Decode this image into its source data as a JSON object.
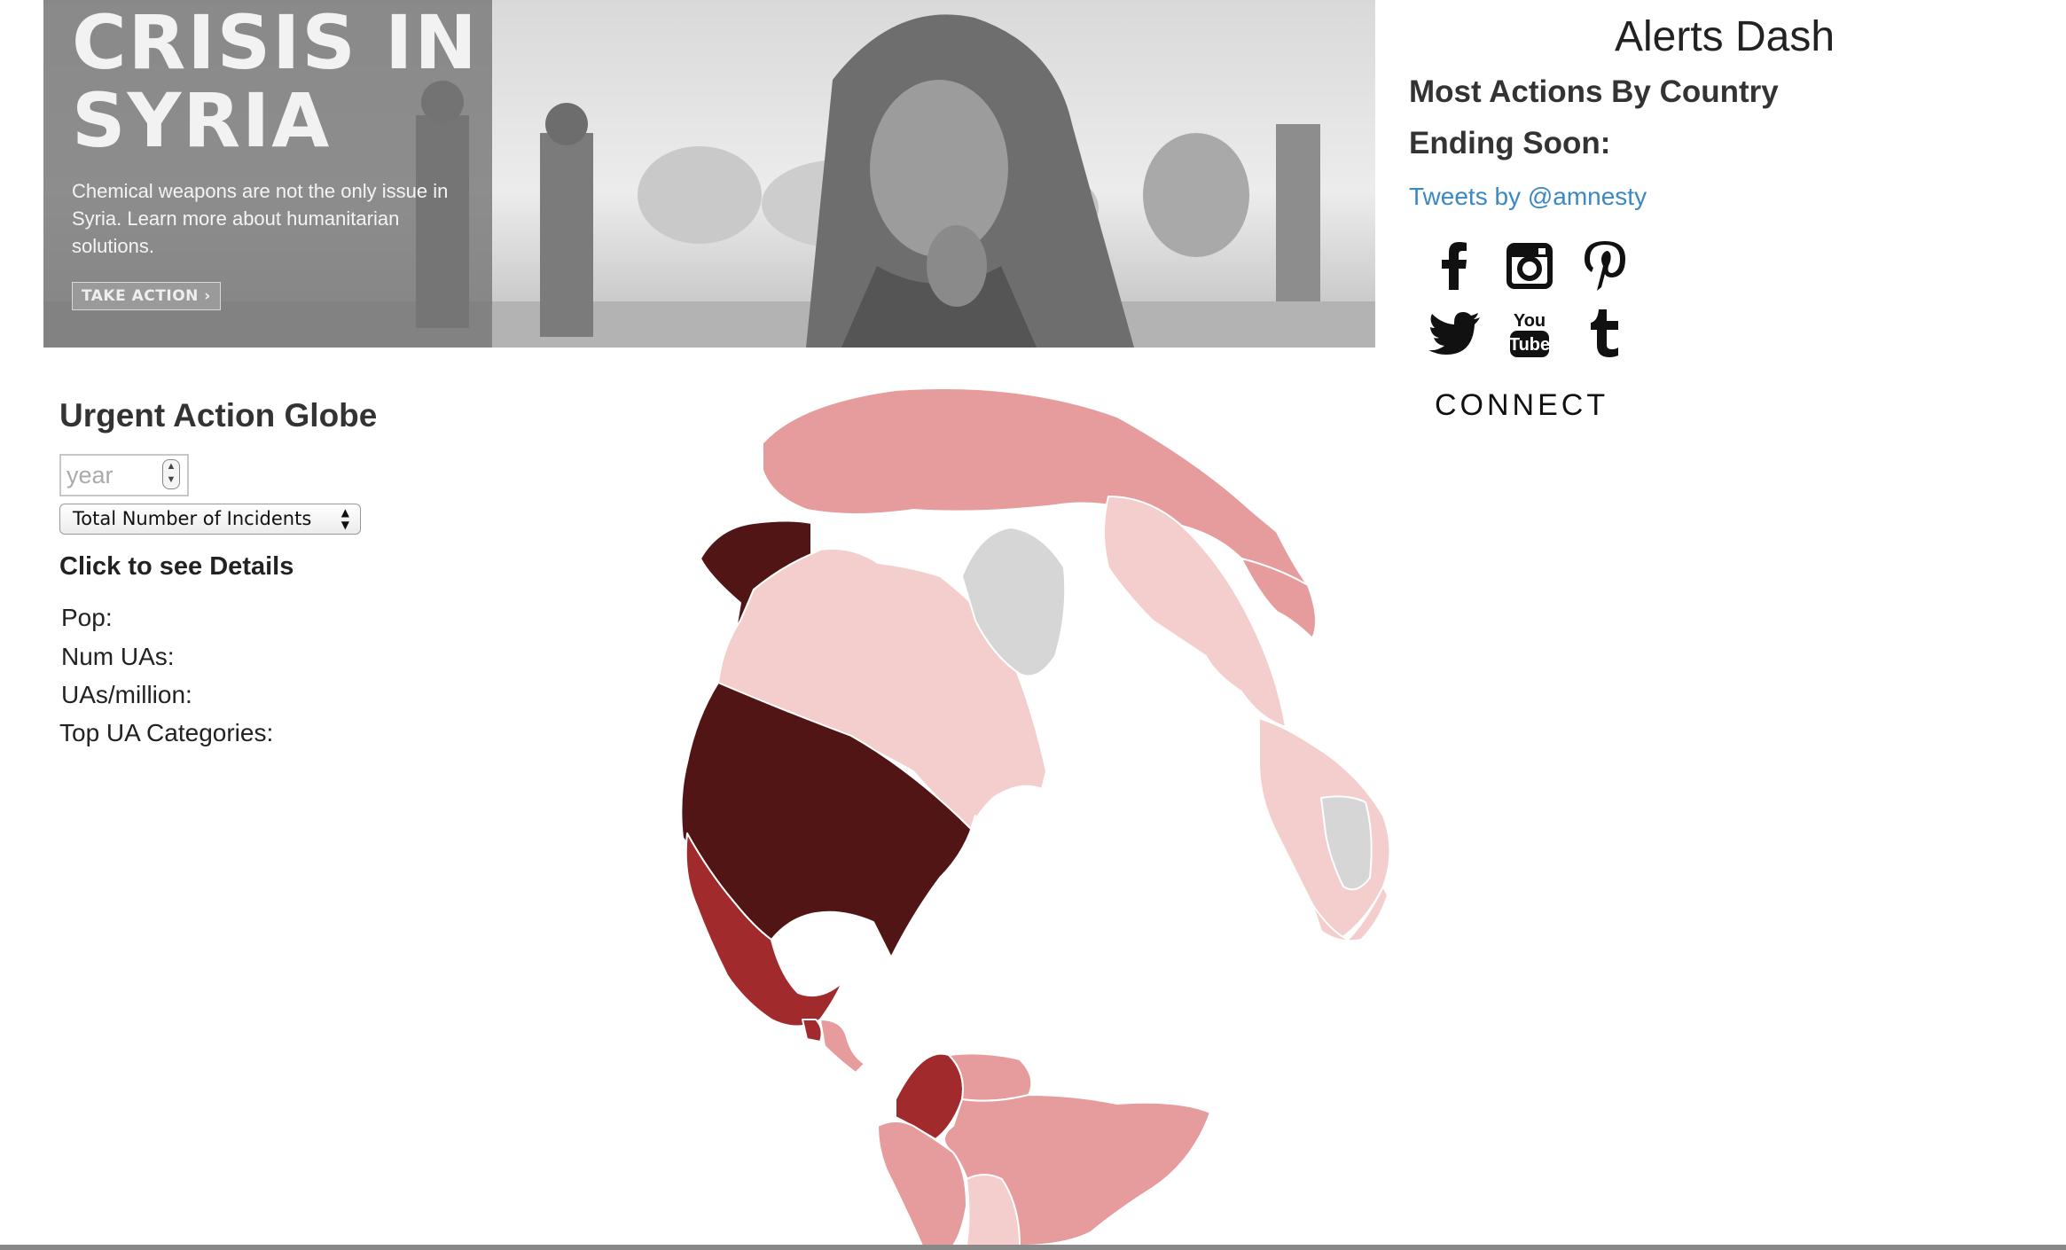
{
  "banner": {
    "title": "CRISIS IN\nSYRIA",
    "text": "Chemical weapons are not the only issue in Syria. Learn more about humanitarian solutions.",
    "button_label": "TAKE ACTION ›"
  },
  "sidebar": {
    "title": "Alerts Dash",
    "most_actions": "Most Actions By Country",
    "ending_soon": "Ending Soon:",
    "tweets_link": "Tweets by @amnesty",
    "connect": "CONNECT",
    "social": [
      "facebook-icon",
      "instagram-icon",
      "pinterest-icon",
      "twitter-icon",
      "youtube-icon",
      "tumblr-icon"
    ],
    "youtube_top": "You",
    "youtube_bottom": "Tube"
  },
  "controls": {
    "globe_title": "Urgent Action Globe",
    "year_placeholder": "year",
    "metric_selected": "Total Number of Incidents",
    "details_heading": "Click to see Details",
    "pop_label": "Pop:",
    "num_uas_label": "Num UAs:",
    "uas_per_million_label": "UAs/million:",
    "top_categories_label": "Top UA Categories:"
  },
  "colors": {
    "very_high": "#521515",
    "high": "#a12a2c",
    "medium": "#e69b9c",
    "low": "#f4cdcd",
    "no_data": "#d6d6d6"
  }
}
